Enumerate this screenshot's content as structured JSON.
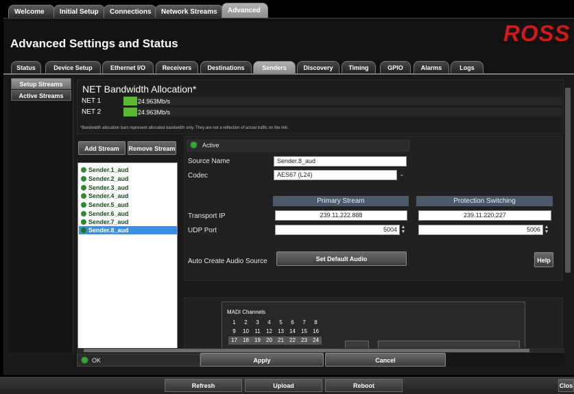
{
  "top_tabs": [
    "Welcome",
    "Initial Setup",
    "Connections",
    "Network Streams",
    "Advanced"
  ],
  "page_title": "Advanced Settings and Status",
  "logo_text": "ROSS",
  "sub_tabs": [
    "Status",
    "Device Setup",
    "Ethernet I/O",
    "Receivers",
    "Destinations",
    "Senders",
    "Discovery",
    "Timing",
    "GPIO",
    "Alarms",
    "Logs"
  ],
  "sidebar": [
    "Setup Streams",
    "Active Streams"
  ],
  "bandwidth": {
    "title": "NET Bandwidth Allocation*",
    "nets": [
      {
        "label": "NET 1",
        "value": "24.963Mb/s"
      },
      {
        "label": "NET 2",
        "value": "24.963Mb/s"
      }
    ],
    "note": "*Bandwidth allocation bars represent allocated bandwidth only. They are not a reflection of actual traffic on the link."
  },
  "stream_buttons": {
    "add": "Add Stream",
    "remove": "Remove Stream"
  },
  "streams": [
    "Sender.1_aud",
    "Sender.2_aud",
    "Sender.3_aud",
    "Sender.4_aud",
    "Sender.5_aud",
    "Sender.6_aud",
    "Sender.7_aud",
    "Sender.8_aud"
  ],
  "detail": {
    "active_label": "Active",
    "source_name_label": "Source Name",
    "source_name_value": "Sender.8_aud",
    "codec_label": "Codec",
    "codec_value": "AES67 (L24)",
    "primary_header": "Primary Stream",
    "protection_header": "Protection Switching",
    "transport_ip_label": "Transport IP",
    "primary_ip": "239.11.222.888",
    "protection_ip": "239.11.220.227",
    "udp_port_label": "UDP Port",
    "primary_port": "5004",
    "protection_port": "5006",
    "auto_create_label": "Auto Create Audio Source",
    "set_default_button": "Set Default Audio",
    "help_button": "Help"
  },
  "madi": {
    "title": "MADI Channels",
    "rows": [
      [
        "1",
        "2",
        "3",
        "4",
        "5",
        "6",
        "7",
        "8"
      ],
      [
        "9",
        "10",
        "11",
        "12",
        "13",
        "14",
        "15",
        "16"
      ],
      [
        "17",
        "18",
        "19",
        "20",
        "21",
        "22",
        "23",
        "24"
      ]
    ]
  },
  "status": {
    "ok": "OK",
    "apply": "Apply",
    "cancel": "Cancel"
  },
  "bottom_buttons": [
    "Refresh",
    "Upload",
    "Reboot",
    "Clos"
  ],
  "colors": {
    "accent_green": "#5ab82e",
    "selected_blue": "#3d8ee0",
    "logo_red": "#d01a1a"
  }
}
